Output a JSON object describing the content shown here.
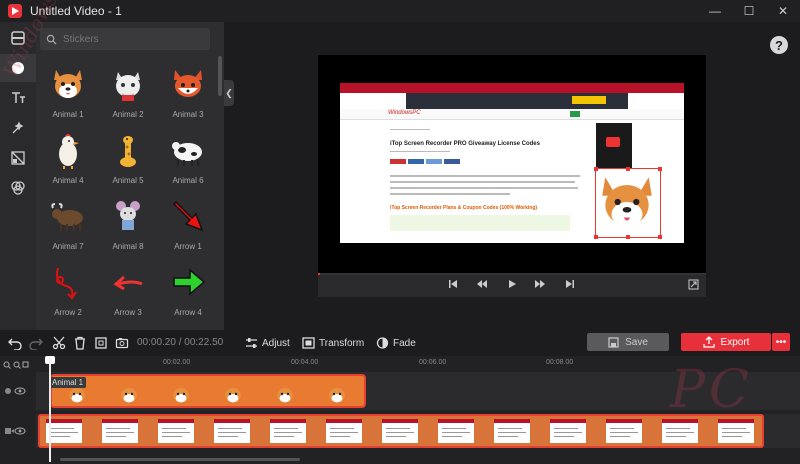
{
  "window": {
    "title": "Untitled Video - 1",
    "minimize": "—",
    "maximize": "☐",
    "close": "✕"
  },
  "sidebar": {
    "search_placeholder": "Stickers"
  },
  "stickers": [
    {
      "label": "Animal 1",
      "kind": "corgi"
    },
    {
      "label": "Animal 2",
      "kind": "cat"
    },
    {
      "label": "Animal 3",
      "kind": "fox"
    },
    {
      "label": "Animal 4",
      "kind": "chicken"
    },
    {
      "label": "Animal 5",
      "kind": "giraffe"
    },
    {
      "label": "Animal 6",
      "kind": "cow"
    },
    {
      "label": "Animal 7",
      "kind": "bull"
    },
    {
      "label": "Animal 8",
      "kind": "mouse"
    },
    {
      "label": "Arrow 1",
      "kind": "arrow-red-down"
    },
    {
      "label": "Arrow 2",
      "kind": "arrow-red-curl"
    },
    {
      "label": "Arrow 3",
      "kind": "arrow-red-left"
    },
    {
      "label": "Arrow 4",
      "kind": "arrow-green-right"
    }
  ],
  "help": "?",
  "player": {
    "progress": 0.0
  },
  "video_page": {
    "site": "WindowsPC",
    "headline": "iTop Screen Recorder PRO Giveaway License Codes",
    "subhead": "iTop Screen Recorder Plans & Coupon Codes (100% Working)"
  },
  "toolbar": {
    "time_current": "00:00.20",
    "time_sep": "/",
    "time_total": "00:22.50",
    "adjust": "Adjust",
    "transform": "Transform",
    "fade": "Fade",
    "save": "Save",
    "export": "Export",
    "more": "•••"
  },
  "timeline": {
    "ticks": [
      "00:02.00",
      "00:04.00",
      "00:06.00",
      "00:08.00"
    ],
    "sticker_clip_label": "Animal 1"
  },
  "watermark": {
    "side": "WindowsPC",
    "corner": "PC"
  },
  "colors": {
    "accent": "#e8303a",
    "clip": "#e87a32",
    "background": "#1c1c1e"
  }
}
